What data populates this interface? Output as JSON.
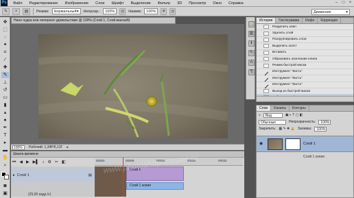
{
  "app": {
    "logo": "Ps"
  },
  "menu": [
    "Файл",
    "Редактирование",
    "Изображение",
    "Слои",
    "Шрифт",
    "Выделение",
    "Фильтр",
    "3D",
    "Просмотр",
    "Окно",
    "Справка"
  ],
  "options": {
    "mode_label": "Режим:",
    "mode_value": "Нормальный",
    "opacity_label": "Непрозр.:",
    "opacity_value": "100%",
    "flow_label": "Нажим:",
    "flow_value": "100%",
    "workspace": "Движение"
  },
  "document": {
    "tab_title": "Нано-чудка или неперное удовольствие @ 100% (Слой 1, Слой-маска/8)",
    "zoom": "100%",
    "status": "Рабочий: 1,34Р/6,13Г"
  },
  "timeline": {
    "title": "Шкала времени",
    "ruler_ticks": [
      "00000",
      "00008",
      "00016",
      "00024",
      "00032"
    ],
    "layer_name": "Слой 1",
    "clip1_label": "Слой 1",
    "clip2_label": "Слой 1 копия",
    "footer": "(25,00 кадр./с)"
  },
  "history": {
    "tabs": [
      "История",
      "Гистограмма",
      "Инфо",
      "Коррекция"
    ],
    "items": [
      {
        "label": "Разделить клип",
        "type": "doc"
      },
      {
        "label": "Удалить слой",
        "type": "doc"
      },
      {
        "label": "Разгруппировать слои",
        "type": "doc"
      },
      {
        "label": "Выделить холст",
        "type": "doc"
      },
      {
        "label": "Вставить",
        "type": "doc"
      },
      {
        "label": "Образовать окончание клипа",
        "type": "doc"
      },
      {
        "label": "Режим быстрой маски",
        "type": "doc"
      },
      {
        "label": "Инструмент \"Кисть\"",
        "type": "brush"
      },
      {
        "label": "Инструмент \"Кисть\"",
        "type": "brush"
      },
      {
        "label": "Инструмент \"Кисть\"",
        "type": "brush"
      },
      {
        "label": "Выход из быстрой маски",
        "type": "doc"
      },
      {
        "label": "Добавить слой-маску",
        "type": "doc",
        "selected": true
      }
    ]
  },
  "layers": {
    "tabs": [
      "Слои",
      "Каналы",
      "Контуры"
    ],
    "kind_label": "Вид",
    "blend_mode": "Обычные",
    "opacity_label": "Непрозрачность:",
    "opacity_value": "100%",
    "lock_label": "Закрепить:",
    "fill_label": "Заливка:",
    "fill_value": "100%",
    "layer_name": "Слой 1",
    "layer_copy": "Слой 1 копия"
  },
  "watermark": "www.photoshop-master.ru"
}
